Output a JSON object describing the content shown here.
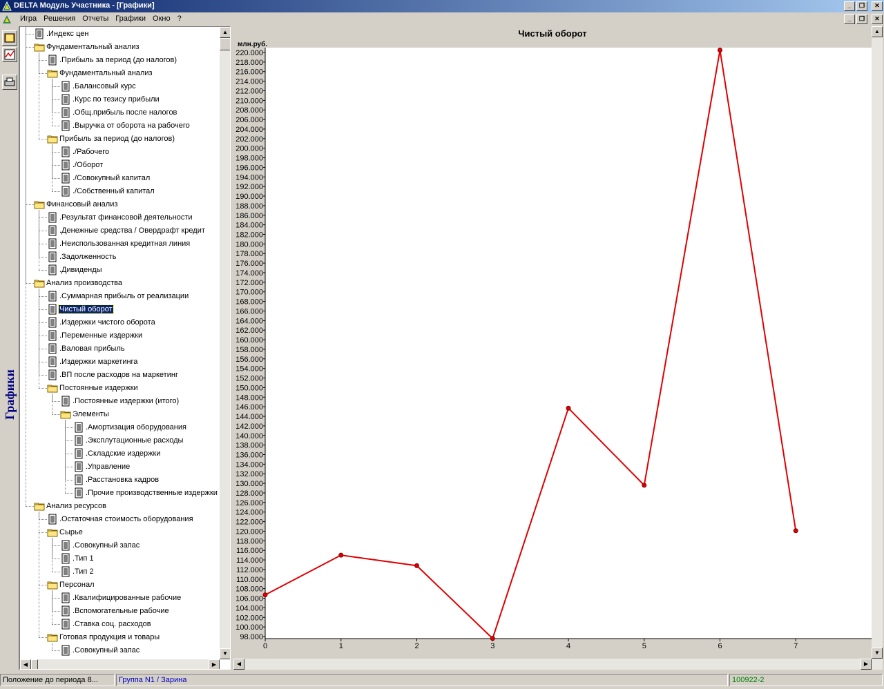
{
  "window": {
    "title": "DELTA Модуль Участника - [Графики]"
  },
  "menu": [
    "Игра",
    "Решения",
    "Отчеты",
    "Графики",
    "Окно",
    "?"
  ],
  "left_toolbar": {
    "vertical_label": "Графики",
    "tools": [
      "book-icon",
      "chart-icon",
      "printer-icon"
    ]
  },
  "tree": [
    {
      "label": ".Индекс цен",
      "level": 1,
      "type": "doc"
    },
    {
      "label": "Фундаментальный анализ",
      "level": 1,
      "type": "folder"
    },
    {
      "label": ".Прибыль за период (до налогов)",
      "level": 2,
      "type": "doc"
    },
    {
      "label": "Фундаментальный анализ",
      "level": 2,
      "type": "folder"
    },
    {
      "label": ".Балансовый курс",
      "level": 3,
      "type": "doc"
    },
    {
      "label": ".Курс по тезису прибыли",
      "level": 3,
      "type": "doc"
    },
    {
      "label": ".Общ.прибыль после налогов",
      "level": 3,
      "type": "doc"
    },
    {
      "label": ".Выручка от оборота на рабочего",
      "level": 3,
      "type": "doc"
    },
    {
      "label": "Прибыль за период (до налогов)",
      "level": 2,
      "type": "folder"
    },
    {
      "label": "./Рабочего",
      "level": 3,
      "type": "doc"
    },
    {
      "label": "./Оборот",
      "level": 3,
      "type": "doc"
    },
    {
      "label": "./Совокупный капитал",
      "level": 3,
      "type": "doc"
    },
    {
      "label": "./Собственный капитал",
      "level": 3,
      "type": "doc"
    },
    {
      "label": "Финансовый анализ",
      "level": 1,
      "type": "folder"
    },
    {
      "label": ".Результат финансовой деятельности",
      "level": 2,
      "type": "doc"
    },
    {
      "label": ".Денежные средства / Овердрафт кредит",
      "level": 2,
      "type": "doc"
    },
    {
      "label": ".Неиспользованная кредитная линия",
      "level": 2,
      "type": "doc"
    },
    {
      "label": ".Задолженность",
      "level": 2,
      "type": "doc"
    },
    {
      "label": ".Дивиденды",
      "level": 2,
      "type": "doc"
    },
    {
      "label": "Анализ производства",
      "level": 1,
      "type": "folder"
    },
    {
      "label": ".Суммарная прибыль от реализации",
      "level": 2,
      "type": "doc"
    },
    {
      "label": "Чистый оборот",
      "level": 2,
      "type": "doc",
      "selected": true
    },
    {
      "label": ".Издержки чистого оборота",
      "level": 2,
      "type": "doc"
    },
    {
      "label": ".Переменные издержки",
      "level": 2,
      "type": "doc"
    },
    {
      "label": ".Валовая прибыль",
      "level": 2,
      "type": "doc"
    },
    {
      "label": ".Издержки маркетинга",
      "level": 2,
      "type": "doc"
    },
    {
      "label": ".ВП после расходов на маркетинг",
      "level": 2,
      "type": "doc"
    },
    {
      "label": "Постоянные издержки",
      "level": 2,
      "type": "folder"
    },
    {
      "label": ".Постоянные издержки (итого)",
      "level": 3,
      "type": "doc"
    },
    {
      "label": "Элементы",
      "level": 3,
      "type": "folder"
    },
    {
      "label": ".Амортизация оборудования",
      "level": 4,
      "type": "doc"
    },
    {
      "label": ".Эксплутационные расходы",
      "level": 4,
      "type": "doc"
    },
    {
      "label": ".Складские издержки",
      "level": 4,
      "type": "doc"
    },
    {
      "label": ".Управление",
      "level": 4,
      "type": "doc"
    },
    {
      "label": ".Расстановка кадров",
      "level": 4,
      "type": "doc"
    },
    {
      "label": ".Прочие производственные издержки",
      "level": 4,
      "type": "doc"
    },
    {
      "label": "Анализ ресурсов",
      "level": 1,
      "type": "folder"
    },
    {
      "label": ".Остаточная стоимость оборудования",
      "level": 2,
      "type": "doc"
    },
    {
      "label": "Сырье",
      "level": 2,
      "type": "folder"
    },
    {
      "label": ".Совокупный запас",
      "level": 3,
      "type": "doc"
    },
    {
      "label": ".Тип 1",
      "level": 3,
      "type": "doc"
    },
    {
      "label": ".Тип 2",
      "level": 3,
      "type": "doc"
    },
    {
      "label": "Персонал",
      "level": 2,
      "type": "folder"
    },
    {
      "label": ".Квалифицированные рабочие",
      "level": 3,
      "type": "doc"
    },
    {
      "label": ".Вспомогательные рабочие",
      "level": 3,
      "type": "doc"
    },
    {
      "label": ".Ставка соц. расходов",
      "level": 3,
      "type": "doc"
    },
    {
      "label": "Готовая продукция и товары",
      "level": 2,
      "type": "folder"
    },
    {
      "label": ".Совокупный запас",
      "level": 3,
      "type": "doc"
    }
  ],
  "chart_data": {
    "type": "line",
    "title": "Чистый оборот",
    "ylabel": "млн.руб.",
    "xlabel": "",
    "x": [
      0,
      1,
      2,
      3,
      4,
      5,
      6,
      7
    ],
    "xlim": [
      0,
      8.0
    ],
    "ylim": [
      98000,
      220000
    ],
    "ytick_step": 2000,
    "grid": false,
    "legend": "none",
    "line_color": "#e00000",
    "series": [
      {
        "values": [
          106700,
          115000,
          112800,
          97600,
          145700,
          129600,
          220500,
          120100
        ]
      }
    ]
  },
  "statusbar": {
    "position": "Положение до периода 8...",
    "group": "Группа N1 / Зарина",
    "code": "100922-2"
  }
}
